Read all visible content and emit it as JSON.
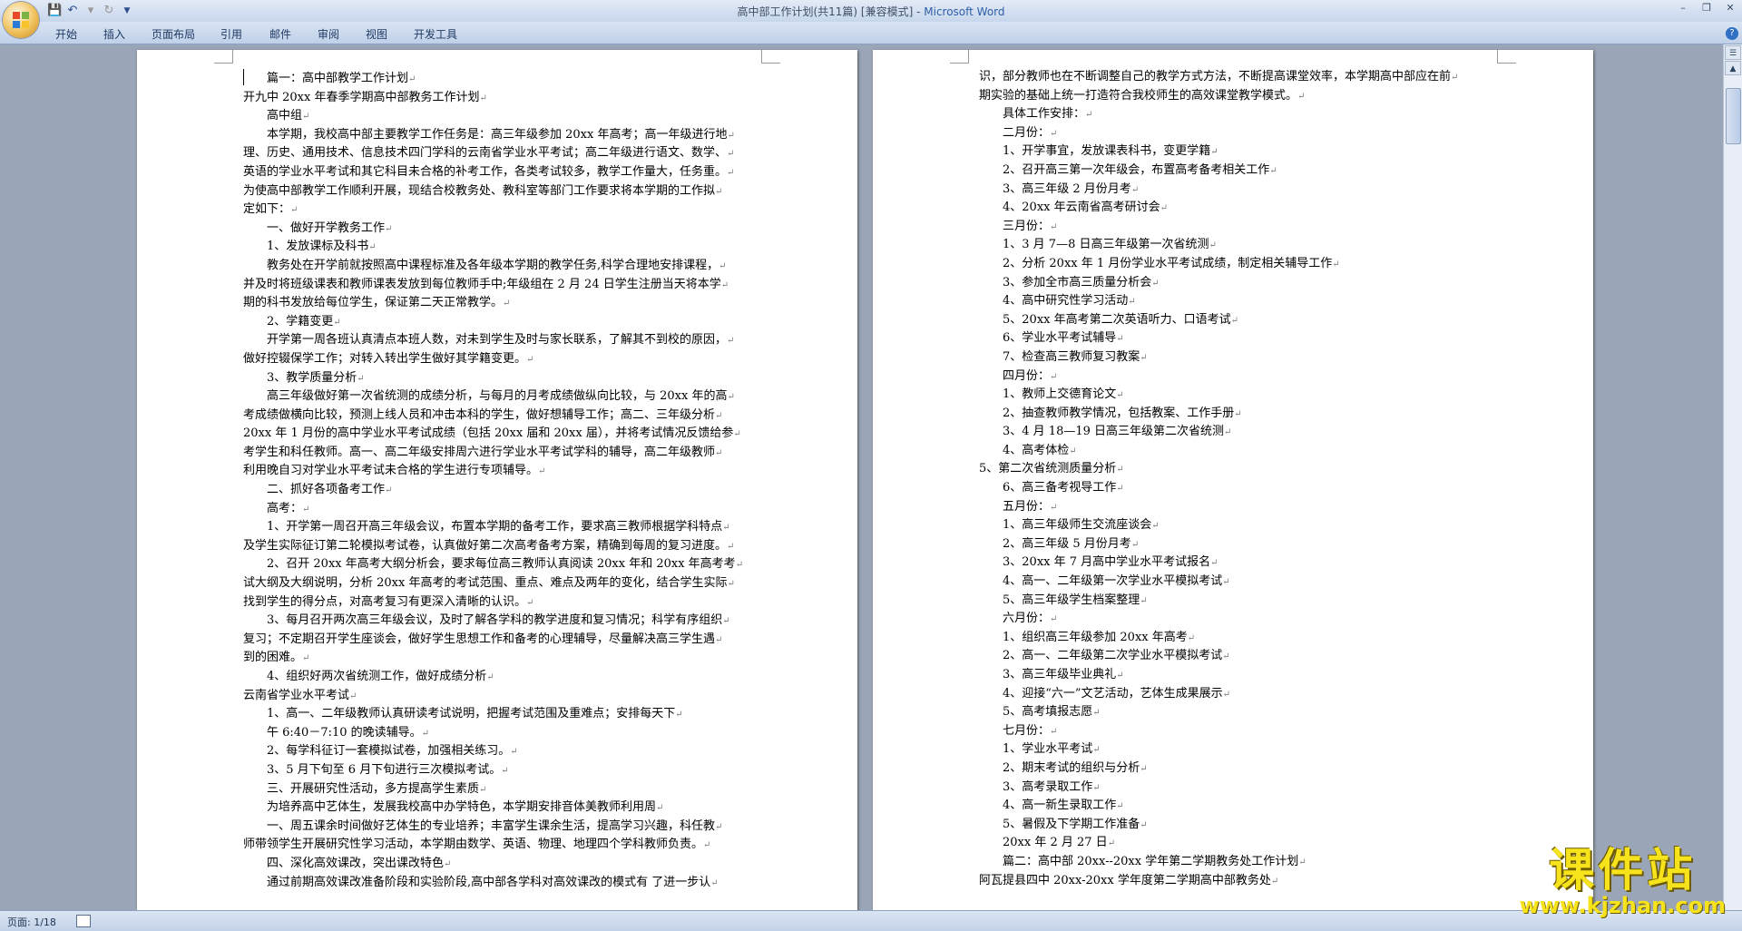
{
  "window": {
    "title_doc": "高中部工作计划(共11篇) [兼容模式]",
    "title_sep": " - ",
    "title_app": "Microsoft Word"
  },
  "ribbon": {
    "tabs": [
      "开始",
      "插入",
      "页面布局",
      "引用",
      "邮件",
      "审阅",
      "视图",
      "开发工具"
    ]
  },
  "status": {
    "page": "页面: 1/18"
  },
  "watermark": {
    "main": "课件站",
    "url": "www.kjzhan.com"
  },
  "page1": [
    {
      "t": "篇一：高中部教学工作计划",
      "i": 1
    },
    {
      "t": "开九中 20xx 年春季学期高中部教务工作计划",
      "i": 0
    },
    {
      "t": "高中组",
      "i": 1
    },
    {
      "t": "本学期，我校高中部主要教学工作任务是：高三年级参加 20xx 年高考；高一年级进行地",
      "i": 1
    },
    {
      "t": "理、历史、通用技术、信息技术四门学科的云南省学业水平考试；高二年级进行语文、数学、",
      "i": 0
    },
    {
      "t": "英语的学业水平考试和其它科目未合格的补考工作，各类考试较多，教学工作量大，任务重。",
      "i": 0
    },
    {
      "t": "为使高中部教学工作顺利开展，现结合校教务处、教科室等部门工作要求将本学期的工作拟",
      "i": 0
    },
    {
      "t": "定如下：",
      "i": 0
    },
    {
      "t": "一、做好开学教务工作",
      "i": 1
    },
    {
      "t": "1、发放课标及科书",
      "i": 1
    },
    {
      "t": "教务处在开学前就按照高中课程标准及各年级本学期的教学任务,科学合理地安排课程，",
      "i": 1
    },
    {
      "t": "并及时将班级课表和教师课表发放到每位教师手中;年级组在 2 月 24 日学生注册当天将本学",
      "i": 0
    },
    {
      "t": "期的科书发放给每位学生，保证第二天正常教学。",
      "i": 0
    },
    {
      "t": "2、学籍变更",
      "i": 1
    },
    {
      "t": "开学第一周各班认真清点本班人数，对未到学生及时与家长联系，了解其不到校的原因，",
      "i": 1
    },
    {
      "t": "做好控辍保学工作；对转入转出学生做好其学籍变更。",
      "i": 0
    },
    {
      "t": "3、教学质量分析",
      "i": 1
    },
    {
      "t": "高三年级做好第一次省统测的成绩分析，与每月的月考成绩做纵向比较，与 20xx 年的高",
      "i": 1
    },
    {
      "t": "考成绩做横向比较，预测上线人员和冲击本科的学生，做好想辅导工作；高二、三年级分析",
      "i": 0
    },
    {
      "t": "20xx 年 1 月份的高中学业水平考试成绩（包括 20xx 届和 20xx 届），并将考试情况反馈给参",
      "i": 0
    },
    {
      "t": "考学生和科任教师。高一、高二年级安排周六进行学业水平考试学科的辅导，高二年级教师",
      "i": 0
    },
    {
      "t": "利用晚自习对学业水平考试未合格的学生进行专项辅导。",
      "i": 0
    },
    {
      "t": "二、抓好各项备考工作",
      "i": 1
    },
    {
      "t": "高考：",
      "i": 1
    },
    {
      "t": "1、开学第一周召开高三年级会议，布置本学期的备考工作，要求高三教师根据学科特点",
      "i": 1
    },
    {
      "t": "及学生实际征订第二轮模拟考试卷，认真做好第二次高考备考方案，精确到每周的复习进度。",
      "i": 0
    },
    {
      "t": "2、召开 20xx 年高考大纲分析会，要求每位高三教师认真阅读 20xx 年和 20xx 年高考考",
      "i": 1
    },
    {
      "t": "试大纲及大纲说明，分析 20xx 年高考的考试范围、重点、难点及两年的变化，结合学生实际",
      "i": 0
    },
    {
      "t": "找到学生的得分点，对高考复习有更深入清晰的认识。",
      "i": 0
    },
    {
      "t": "3、每月召开两次高三年级会议，及时了解各学科的教学进度和复习情况；科学有序组织",
      "i": 1
    },
    {
      "t": "复习；不定期召开学生座谈会，做好学生思想工作和备考的心理辅导，尽量解决高三学生遇",
      "i": 0
    },
    {
      "t": "到的困难。",
      "i": 0
    },
    {
      "t": "4、组织好两次省统测工作，做好成绩分析",
      "i": 1
    },
    {
      "t": "云南省学业水平考试",
      "i": 0
    },
    {
      "t": "1、高一、二年级教师认真研读考试说明，把握考试范围及重难点；安排每天下",
      "i": 1
    },
    {
      "t": "午 6:40－7:10 的晚读辅导。",
      "i": 1
    },
    {
      "t": "2、每学科征订一套模拟试卷，加强相关练习。",
      "i": 1
    },
    {
      "t": "3、5 月下旬至 6 月下旬进行三次模拟考试。",
      "i": 1
    },
    {
      "t": "三、开展研究性活动，多方提高学生素质",
      "i": 1
    },
    {
      "t": "为培养高中艺体生，发展我校高中办学特色，本学期安排音体美教师利用周",
      "i": 1
    },
    {
      "t": "一、周五课余时间做好艺体生的专业培养；丰富学生课余生活，提高学习兴趣，科任教",
      "i": 1
    },
    {
      "t": "师带领学生开展研究性学习活动，本学期由数学、英语、物理、地理四个学科教师负责。",
      "i": 0
    },
    {
      "t": "四、深化高效课改，突出课改特色",
      "i": 1
    },
    {
      "t": "通过前期高效课改准备阶段和实验阶段,高中部各学科对高效课改的模式有 了进一步认",
      "i": 1
    }
  ],
  "page2": [
    {
      "t": "识，部分教师也在不断调整自己的教学方式方法，不断提高课堂效率，本学期高中部应在前",
      "i": 0
    },
    {
      "t": "期实验的基础上统一打造符合我校师生的高效课堂教学模式。",
      "i": 0
    },
    {
      "t": "具体工作安排：",
      "i": 1
    },
    {
      "t": "二月份：",
      "i": 1
    },
    {
      "t": "1、开学事宜，发放课表科书，变更学籍",
      "i": 1
    },
    {
      "t": "2、召开高三第一次年级会，布置高考备考相关工作",
      "i": 1
    },
    {
      "t": "3、高三年级 2 月份月考",
      "i": 1
    },
    {
      "t": "4、20xx 年云南省高考研讨会",
      "i": 1
    },
    {
      "t": "三月份：",
      "i": 1
    },
    {
      "t": "1、3 月 7—8 日高三年级第一次省统测",
      "i": 1
    },
    {
      "t": "2、分析 20xx 年 1 月份学业水平考试成绩，制定相关辅导工作",
      "i": 1
    },
    {
      "t": "3、参加全市高三质量分析会",
      "i": 1
    },
    {
      "t": "4、高中研究性学习活动",
      "i": 1
    },
    {
      "t": "5、20xx 年高考第二次英语听力、口语考试",
      "i": 1
    },
    {
      "t": "6、学业水平考试辅导",
      "i": 1
    },
    {
      "t": "7、检查高三教师复习教案",
      "i": 1
    },
    {
      "t": "四月份：",
      "i": 1
    },
    {
      "t": "1、教师上交德育论文",
      "i": 1
    },
    {
      "t": "2、抽查教师教学情况，包括教案、工作手册",
      "i": 1
    },
    {
      "t": "3、4 月 18—19 日高三年级第二次省统测",
      "i": 1
    },
    {
      "t": "4、高考体检",
      "i": 1
    },
    {
      "t": "5、第二次省统测质量分析",
      "i": 0
    },
    {
      "t": "6、高三备考视导工作",
      "i": 1
    },
    {
      "t": "五月份：",
      "i": 1
    },
    {
      "t": "1、高三年级师生交流座谈会",
      "i": 1
    },
    {
      "t": "2、高三年级 5 月份月考",
      "i": 1
    },
    {
      "t": "3、20xx 年 7 月高中学业水平考试报名",
      "i": 1
    },
    {
      "t": "4、高一、二年级第一次学业水平模拟考试",
      "i": 1
    },
    {
      "t": "5、高三年级学生档案整理",
      "i": 1
    },
    {
      "t": "六月份：",
      "i": 1
    },
    {
      "t": "1、组织高三年级参加 20xx 年高考",
      "i": 1
    },
    {
      "t": "2、高一、二年级第二次学业水平模拟考试",
      "i": 1
    },
    {
      "t": "3、高三年级毕业典礼",
      "i": 1
    },
    {
      "t": "4、迎接“六一”文艺活动，艺体生成果展示",
      "i": 1
    },
    {
      "t": "5、高考填报志愿",
      "i": 1
    },
    {
      "t": "七月份：",
      "i": 1
    },
    {
      "t": "1、学业水平考试",
      "i": 1
    },
    {
      "t": "2、期末考试的组织与分析",
      "i": 1
    },
    {
      "t": "3、高考录取工作",
      "i": 1
    },
    {
      "t": "4、高一新生录取工作",
      "i": 1
    },
    {
      "t": "5、暑假及下学期工作准备",
      "i": 1
    },
    {
      "t": "20xx 年 2 月 27 日",
      "i": 1
    },
    {
      "t": "篇二：高中部 20xx--20xx 学年第二学期教务处工作计划",
      "i": 1
    },
    {
      "t": "阿瓦提县四中 20xx-20xx 学年度第二学期高中部教务处",
      "i": 0
    }
  ]
}
